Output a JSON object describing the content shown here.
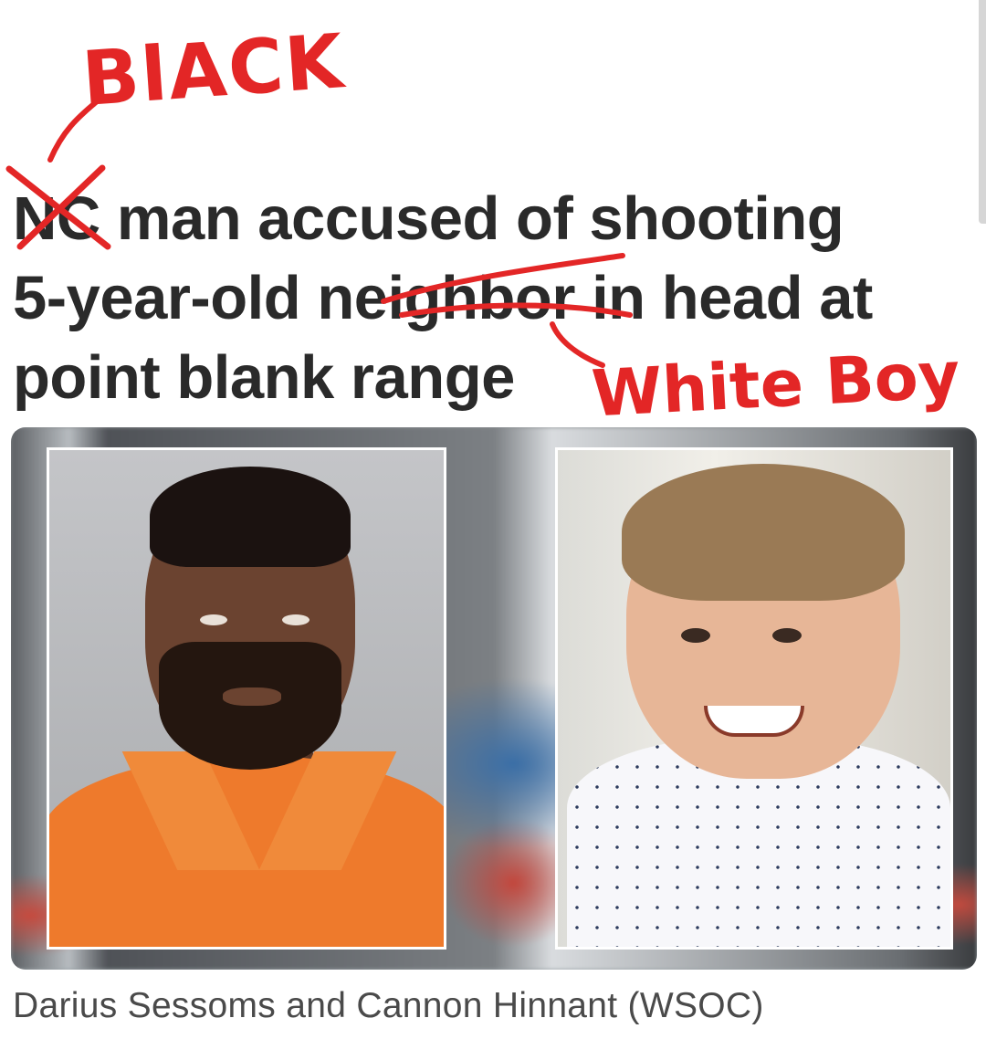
{
  "headline": {
    "line1_word1": "NC",
    "line1_rest": "man accused of shooting",
    "line2_start": "5-year-old",
    "line2_word": "neighbor",
    "line2_rest": "in head at",
    "line3": "point blank range"
  },
  "annotations": {
    "replacement_top": "BlACK",
    "replacement_bottom": "White Boy",
    "color": "#e32626"
  },
  "photos": {
    "left_icon": "mugshot-photo",
    "right_icon": "child-photo"
  },
  "caption": "Darius Sessoms and Cannon Hinnant (WSOC)"
}
